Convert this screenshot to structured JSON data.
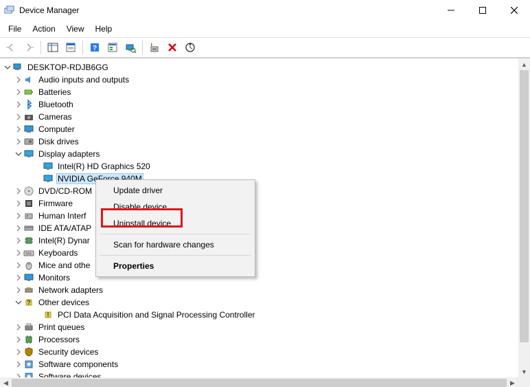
{
  "title": "Device Manager",
  "window_controls": {
    "min": "—",
    "max": "▢",
    "close": "✕"
  },
  "menubar": [
    "File",
    "Action",
    "View",
    "Help"
  ],
  "tree": {
    "root": "DESKTOP-RDJB6GG",
    "nodes": [
      {
        "label": "Audio inputs and outputs",
        "icon": "audio",
        "expand": "closed"
      },
      {
        "label": "Batteries",
        "icon": "battery",
        "expand": "closed"
      },
      {
        "label": "Bluetooth",
        "icon": "bluetooth",
        "expand": "closed"
      },
      {
        "label": "Cameras",
        "icon": "camera",
        "expand": "closed"
      },
      {
        "label": "Computer",
        "icon": "computer",
        "expand": "closed"
      },
      {
        "label": "Disk drives",
        "icon": "disk",
        "expand": "closed"
      },
      {
        "label": "Display adapters",
        "icon": "display",
        "expand": "open",
        "children": [
          {
            "label": "Intel(R) HD Graphics 520",
            "icon": "display"
          },
          {
            "label": "NVIDIA GeForce 940M",
            "icon": "display",
            "selected": true
          }
        ]
      },
      {
        "label": "DVD/CD-ROM",
        "icon": "dvd",
        "expand": "closed",
        "truncated": true
      },
      {
        "label": "Firmware",
        "icon": "firmware",
        "expand": "closed"
      },
      {
        "label": "Human Interf",
        "icon": "hid",
        "expand": "closed",
        "truncated": true
      },
      {
        "label": "IDE ATA/ATAP",
        "icon": "ide",
        "expand": "closed",
        "truncated": true
      },
      {
        "label": "Intel(R) Dynar",
        "icon": "chip",
        "expand": "closed",
        "truncated": true
      },
      {
        "label": "Keyboards",
        "icon": "keyboard",
        "expand": "closed"
      },
      {
        "label": "Mice and othe",
        "icon": "mouse",
        "expand": "closed",
        "truncated": true
      },
      {
        "label": "Monitors",
        "icon": "monitor",
        "expand": "closed"
      },
      {
        "label": "Network adapters",
        "icon": "network",
        "expand": "closed"
      },
      {
        "label": "Other devices",
        "icon": "other",
        "expand": "open",
        "children": [
          {
            "label": "PCI Data Acquisition and Signal Processing Controller",
            "icon": "other-warn"
          }
        ]
      },
      {
        "label": "Print queues",
        "icon": "print",
        "expand": "closed"
      },
      {
        "label": "Processors",
        "icon": "cpu",
        "expand": "closed"
      },
      {
        "label": "Security devices",
        "icon": "security",
        "expand": "closed"
      },
      {
        "label": "Software components",
        "icon": "software",
        "expand": "closed"
      },
      {
        "label": "Software devices",
        "icon": "software",
        "expand": "closed",
        "cutoff": true
      }
    ]
  },
  "context_menu": {
    "items": [
      {
        "label": "Update driver"
      },
      {
        "label": "Disable device"
      },
      {
        "label": "Uninstall device",
        "highlighted": true
      },
      {
        "sep": true
      },
      {
        "label": "Scan for hardware changes"
      },
      {
        "sep": true
      },
      {
        "label": "Properties",
        "bold": true
      }
    ]
  }
}
